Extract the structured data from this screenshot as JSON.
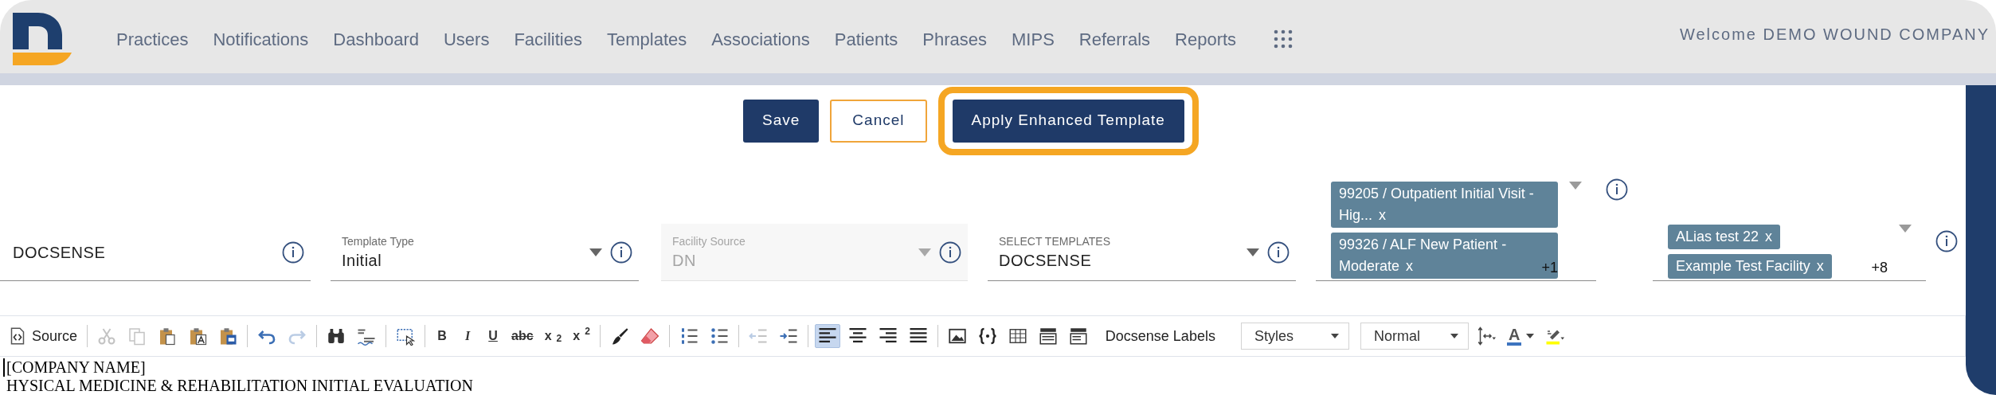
{
  "header": {
    "nav": [
      "Practices",
      "Notifications",
      "Dashboard",
      "Users",
      "Facilities",
      "Templates",
      "Associations",
      "Patients",
      "Phrases",
      "MIPS",
      "Referrals",
      "Reports"
    ],
    "welcome": "Welcome DEMO WOUND COMPANY"
  },
  "actions": [
    {
      "label": "Save",
      "kind": "primary",
      "highlighted": false
    },
    {
      "label": "Cancel",
      "kind": "outline",
      "highlighted": false
    },
    {
      "label": "Apply Enhanced Template",
      "kind": "primary",
      "highlighted": true
    }
  ],
  "fields": [
    {
      "kind": "text",
      "value": "DOCSENSE",
      "disabled": false
    },
    {
      "kind": "select",
      "label": "Template Type",
      "value": "Initial",
      "disabled": false
    },
    {
      "kind": "select",
      "label": "Facility Source",
      "value": "DN",
      "disabled": true
    },
    {
      "kind": "select",
      "label": "SELECT TEMPLATES",
      "value": "DOCSENSE",
      "disabled": false
    },
    {
      "kind": "chips",
      "chips": [
        {
          "label": "99205 / Outpatient Initial Visit - Hig...",
          "remove": "x"
        },
        {
          "label": "99326 / ALF New Patient - Moderate",
          "remove": "x"
        }
      ],
      "more": "+1",
      "disabled": false
    },
    {
      "kind": "chips",
      "chips": [
        {
          "label": "ALias test 22",
          "remove": "x"
        },
        {
          "label": "Example Test Facility",
          "remove": "x"
        }
      ],
      "more": "+8",
      "disabled": false
    }
  ],
  "toolbar": [
    {
      "kind": "source",
      "label": "Source",
      "disabled": false,
      "selected": false
    },
    {
      "kind": "separator"
    },
    {
      "kind": "icon",
      "disabled": true,
      "selected": false
    },
    {
      "kind": "icon",
      "disabled": true,
      "selected": false
    },
    {
      "kind": "icon",
      "disabled": false,
      "selected": false
    },
    {
      "kind": "icon",
      "disabled": false,
      "selected": false
    },
    {
      "kind": "icon",
      "disabled": false,
      "selected": false
    },
    {
      "kind": "separator"
    },
    {
      "kind": "icon",
      "disabled": false,
      "selected": false
    },
    {
      "kind": "icon",
      "disabled": true,
      "selected": false
    },
    {
      "kind": "separator"
    },
    {
      "kind": "icon",
      "disabled": false,
      "selected": false
    },
    {
      "kind": "icon",
      "disabled": false,
      "selected": false
    },
    {
      "kind": "separator"
    },
    {
      "kind": "icon",
      "disabled": false,
      "selected": false
    },
    {
      "kind": "separator"
    },
    {
      "kind": "glyph",
      "label": "B",
      "disabled": false,
      "selected": false
    },
    {
      "kind": "glyph",
      "label": "I",
      "disabled": false,
      "selected": false
    },
    {
      "kind": "glyph",
      "label": "U",
      "disabled": false,
      "selected": false
    },
    {
      "kind": "glyph",
      "label": "abc",
      "disabled": false,
      "selected": false
    },
    {
      "kind": "glyph",
      "label": "x$_{2}$",
      "disabled": false,
      "selected": false
    },
    {
      "kind": "glyph",
      "label": "x$^{2}$",
      "disabled": false,
      "selected": false
    },
    {
      "kind": "separator"
    },
    {
      "kind": "icon",
      "disabled": false,
      "selected": false
    },
    {
      "kind": "icon",
      "disabled": false,
      "selected": false
    },
    {
      "kind": "separator"
    },
    {
      "kind": "icon",
      "disabled": false,
      "selected": false
    },
    {
      "kind": "icon",
      "disabled": false,
      "selected": false
    },
    {
      "kind": "separator"
    },
    {
      "kind": "icon",
      "disabled": true,
      "selected": false
    },
    {
      "kind": "icon",
      "disabled": false,
      "selected": false
    },
    {
      "kind": "separator"
    },
    {
      "kind": "icon",
      "disabled": false,
      "selected": true
    },
    {
      "kind": "icon",
      "disabled": false,
      "selected": false
    },
    {
      "kind": "icon",
      "disabled": false,
      "selected": false
    },
    {
      "kind": "icon",
      "disabled": false,
      "selected": false
    },
    {
      "kind": "separator"
    },
    {
      "kind": "icon",
      "disabled": false,
      "selected": false
    },
    {
      "kind": "icon",
      "disabled": false,
      "selected": false
    },
    {
      "kind": "icon",
      "disabled": false,
      "selected": false
    },
    {
      "kind": "icon",
      "disabled": false,
      "selected": false
    },
    {
      "kind": "icon",
      "disabled": false,
      "selected": false
    },
    {
      "kind": "text",
      "label": "Docsense Labels",
      "disabled": false,
      "selected": false
    },
    {
      "kind": "dropdown",
      "label": "Styles"
    },
    {
      "kind": "dropdown",
      "label": "Normal"
    },
    {
      "kind": "icon",
      "disabled": false,
      "selected": false
    },
    {
      "kind": "color",
      "label": "A",
      "disabled": false,
      "selected": false
    },
    {
      "kind": "icon",
      "disabled": false,
      "selected": false
    }
  ],
  "editor": {
    "lines": [
      "[COMPANY NAME]",
      "HYSICAL MEDICINE & REHABILITATION INITIAL EVALUATION"
    ]
  }
}
